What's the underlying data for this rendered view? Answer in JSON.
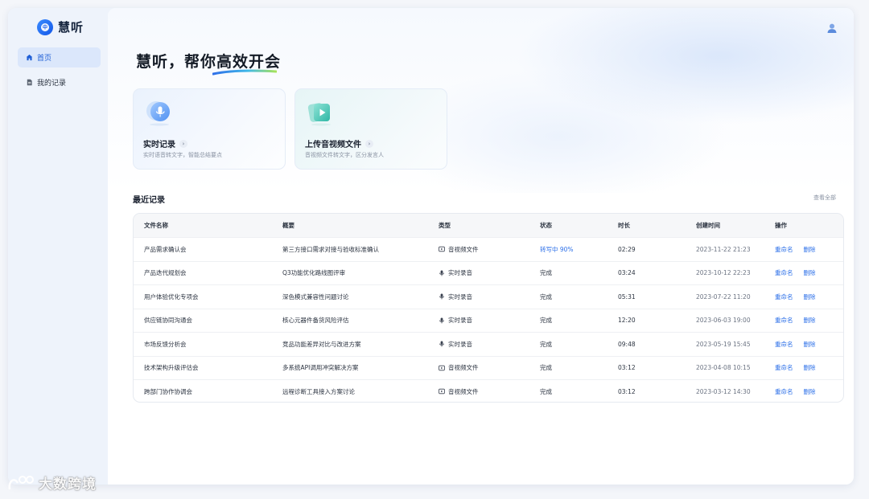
{
  "brand": {
    "name": "慧听",
    "logo_text": "中"
  },
  "sidebar": {
    "items": [
      {
        "label": "首页",
        "icon": "home-icon",
        "active": true
      },
      {
        "label": "我的记录",
        "icon": "document-icon",
        "active": false
      }
    ]
  },
  "header": {
    "user_icon": "user-icon"
  },
  "hero": {
    "title": "慧听，帮你高效开会"
  },
  "cards": [
    {
      "title": "实时记录",
      "desc": "实时语音转文字，智能总结要点",
      "icon": "microphone-icon"
    },
    {
      "title": "上传音视频文件",
      "desc": "音视频文件转文字，区分发言人",
      "icon": "video-file-icon"
    }
  ],
  "recent": {
    "title": "最近记录",
    "view_all": "查看全部",
    "columns": [
      "文件名称",
      "概要",
      "类型",
      "状态",
      "时长",
      "创建时间",
      "操作"
    ],
    "rows": [
      {
        "name": "产品需求确认会",
        "summary": "第三方接口需求对接与验收标准确认",
        "type": "音视频文件",
        "type_icon": "video-icon",
        "status": "转写中 90%",
        "in_progress": true,
        "duration": "02:29",
        "created": "2023-11-22 21:23"
      },
      {
        "name": "产品迭代规划会",
        "summary": "Q3功能优化路线图评审",
        "type": "实时录音",
        "type_icon": "microphone-icon",
        "status": "完成",
        "in_progress": false,
        "duration": "03:24",
        "created": "2023-10-12 22:23"
      },
      {
        "name": "用户体验优化专项会",
        "summary": "深色模式兼容性问题讨论",
        "type": "实时录音",
        "type_icon": "microphone-icon",
        "status": "完成",
        "in_progress": false,
        "duration": "05:31",
        "created": "2023-07-22 11:20"
      },
      {
        "name": "供应链协同沟通会",
        "summary": "核心元器件备货风险评估",
        "type": "实时录音",
        "type_icon": "microphone-icon",
        "status": "完成",
        "in_progress": false,
        "duration": "12:20",
        "created": "2023-06-03 19:00"
      },
      {
        "name": "市场反馈分析会",
        "summary": "竞品功能差异对比与改进方案",
        "type": "实时录音",
        "type_icon": "microphone-icon",
        "status": "完成",
        "in_progress": false,
        "duration": "09:48",
        "created": "2023-05-19 15:45"
      },
      {
        "name": "技术架构升级评估会",
        "summary": "多系统API调用冲突解决方案",
        "type": "音视频文件",
        "type_icon": "video-icon",
        "status": "完成",
        "in_progress": false,
        "duration": "03:12",
        "created": "2023-04-08 10:15"
      },
      {
        "name": "跨部门协作协调会",
        "summary": "远程诊断工具接入方案讨论",
        "type": "音视频文件",
        "type_icon": "video-icon",
        "status": "完成",
        "in_progress": false,
        "duration": "03:12",
        "created": "2023-03-12 14:30"
      }
    ],
    "actions": {
      "rename": "重命名",
      "delete": "删除"
    }
  },
  "watermark": {
    "text": "大数跨境"
  },
  "colors": {
    "accent": "#2a6ee8",
    "active_nav_bg": "#dbe7fb",
    "sidebar_bg": "#eef3fb"
  }
}
